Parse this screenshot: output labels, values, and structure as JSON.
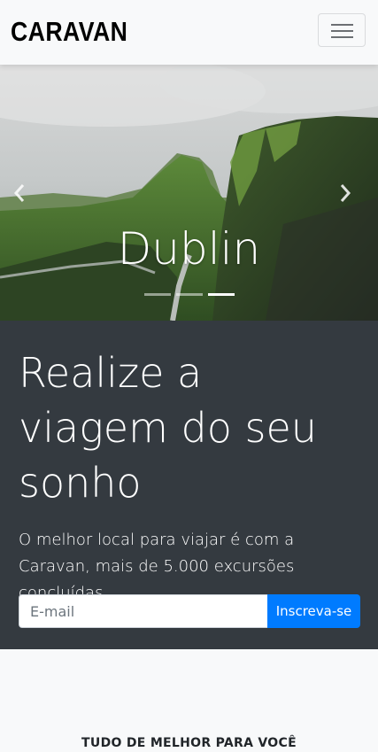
{
  "navbar": {
    "brand": "CARAVAN",
    "toggler_icon": "hamburger-menu-icon"
  },
  "carousel": {
    "caption": "Dublin",
    "prev_icon": "chevron-left-icon",
    "next_icon": "chevron-right-icon",
    "slide_count": 3,
    "active_slide": 3
  },
  "hero": {
    "headline": "Realize a viagem do seu sonho",
    "lead": "O melhor local para viajar é com a Caravan, mais de 5.000 excursões concluídas."
  },
  "signup": {
    "email_placeholder": "E-mail",
    "email_value": "",
    "button_label": "Inscreva-se"
  },
  "section": {
    "title": "TUDO DE MELHOR PARA VOCÊ"
  },
  "colors": {
    "dark_bg": "#343a40",
    "primary": "#007bff",
    "light_bg": "#f8f9fa"
  }
}
